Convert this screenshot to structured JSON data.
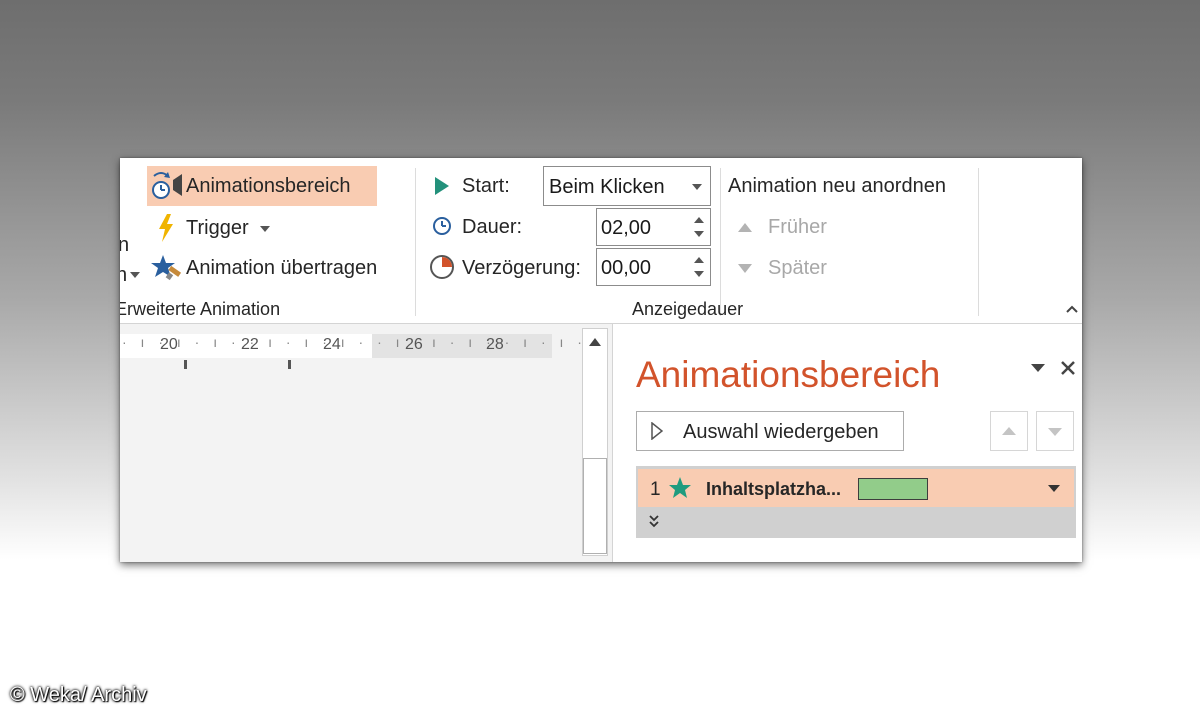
{
  "ribbon": {
    "partial_left_top": "n",
    "partial_left_mid": "n",
    "advanced": {
      "animation_pane_button": "Animationsbereich",
      "trigger_button": "Trigger",
      "animation_painter_button": "Animation übertragen",
      "group_label": "Erweiterte Animation"
    },
    "timing": {
      "start_label": "Start:",
      "start_value": "Beim Klicken",
      "duration_label": "Dauer:",
      "duration_value": "02,00",
      "delay_label": "Verzögerung:",
      "delay_value": "00,00",
      "group_label": "Anzeigedauer"
    },
    "reorder": {
      "title": "Animation neu anordnen",
      "earlier": "Früher",
      "later": "Später"
    }
  },
  "ruler": {
    "ticks": [
      "20",
      "22",
      "24",
      "26",
      "28"
    ]
  },
  "animation_pane": {
    "title": "Animationsbereich",
    "play_button": "Auswahl wiedergeben",
    "items": [
      {
        "index": "1",
        "name": "Inhaltsplatzha...",
        "effect_color": "#92cc8a"
      }
    ]
  },
  "colors": {
    "accent_title": "#d2532b",
    "selection": "#f9ccb2",
    "effect_star": "#1f9c7f"
  },
  "watermark": "© Weka/ Archiv"
}
